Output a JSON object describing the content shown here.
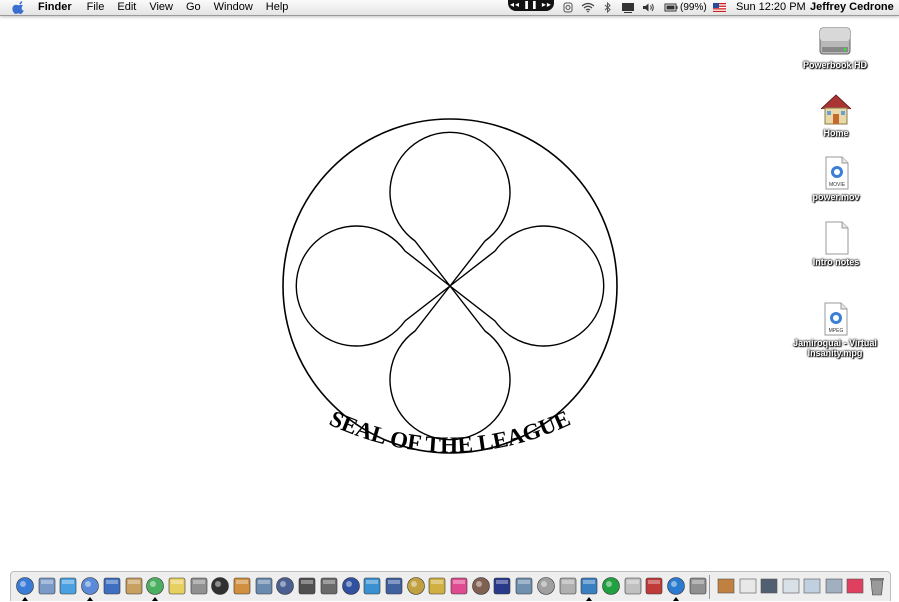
{
  "menubar": {
    "app_name": "Finder",
    "menus": [
      "File",
      "Edit",
      "View",
      "Go",
      "Window",
      "Help"
    ],
    "battery": "(99%)",
    "clock": "Sun 12:20 PM",
    "user": "Jeffrey Cedrone"
  },
  "desktop_icons": [
    {
      "label": "Powerbook HD",
      "icon": "hard-drive-icon"
    },
    {
      "label": "Home",
      "icon": "home-folder-icon"
    },
    {
      "label": "power.mov",
      "icon": "movie-file-icon",
      "badge": "MOVIE"
    },
    {
      "label": "Intro notes",
      "icon": "document-icon"
    },
    {
      "label": "Jamiroquai - Virtual Insanity.mpg",
      "icon": "mpeg-file-icon",
      "badge": "MPEG"
    }
  ],
  "seal": {
    "caption": "SEAL OF THE LEAGUE"
  },
  "dock": {
    "apps": [
      "finder",
      "mail",
      "safari",
      "ichat",
      "spotlight",
      "address-book",
      "itunes",
      "stickies",
      "calculator",
      "terminal",
      "garageband",
      "iphoto",
      "imovie",
      "dvd-player",
      "final-cut",
      "idvd",
      "quicktime",
      "keynote",
      "pencil",
      "text-edit",
      "flower",
      "tools",
      "stars",
      "utility",
      "preview",
      "ipod",
      "network",
      "green",
      "script",
      "ical",
      "quicktime-player",
      "system-prefs"
    ],
    "docs": [
      "home-folder",
      "document-a",
      "window-a",
      "window-b",
      "window-c",
      "phone",
      "flower-b",
      "trash"
    ]
  },
  "colors": {
    "menubar_top": "#fafafa",
    "menubar_bottom": "#e4e4e4",
    "desktop": "#ffffff"
  }
}
